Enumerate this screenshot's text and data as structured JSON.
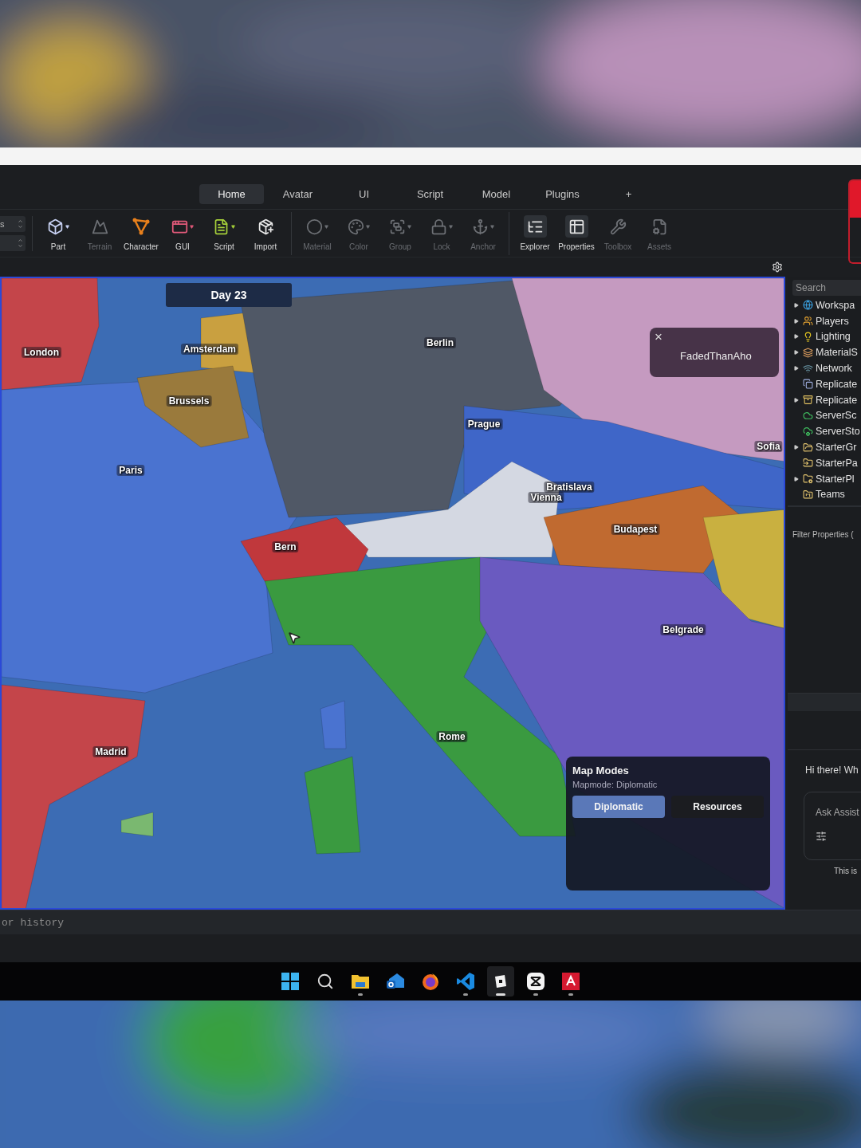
{
  "ribbon_tabs": [
    {
      "label": "Home",
      "selected": true
    },
    {
      "label": "Avatar",
      "selected": false
    },
    {
      "label": "UI",
      "selected": false
    },
    {
      "label": "Script",
      "selected": false
    },
    {
      "label": "Model",
      "selected": false
    },
    {
      "label": "Plugins",
      "selected": false
    },
    {
      "label": "+",
      "selected": false
    }
  ],
  "spinner_label": "s",
  "tool_groups": [
    [
      {
        "label": "Part",
        "disabled": false,
        "dropdown": true,
        "active": false
      },
      {
        "label": "Terrain",
        "disabled": true,
        "dropdown": false,
        "active": false
      },
      {
        "label": "Character",
        "disabled": false,
        "dropdown": false,
        "active": false
      },
      {
        "label": "GUI",
        "disabled": false,
        "dropdown": true,
        "active": false
      },
      {
        "label": "Script",
        "disabled": false,
        "dropdown": true,
        "active": false
      },
      {
        "label": "Import",
        "disabled": false,
        "dropdown": false,
        "active": false
      }
    ],
    [
      {
        "label": "Material",
        "disabled": true,
        "dropdown": true,
        "active": false
      },
      {
        "label": "Color",
        "disabled": true,
        "dropdown": true,
        "active": false
      },
      {
        "label": "Group",
        "disabled": true,
        "dropdown": true,
        "active": false
      },
      {
        "label": "Lock",
        "disabled": true,
        "dropdown": true,
        "active": false
      },
      {
        "label": "Anchor",
        "disabled": true,
        "dropdown": true,
        "active": false
      }
    ],
    [
      {
        "label": "Explorer",
        "disabled": false,
        "dropdown": false,
        "active": true
      },
      {
        "label": "Properties",
        "disabled": false,
        "dropdown": false,
        "active": true
      },
      {
        "label": "Toolbox",
        "disabled": true,
        "dropdown": false,
        "active": false
      },
      {
        "label": "Assets",
        "disabled": true,
        "dropdown": false,
        "active": false
      }
    ]
  ],
  "map": {
    "day": "Day 23",
    "cities": [
      "London",
      "Amsterdam",
      "Berlin",
      "Brussels",
      "Prague",
      "Paris",
      "Sofia",
      "Bratislava",
      "Vienna",
      "Budapest",
      "Bern",
      "Belgrade",
      "Rome",
      "Madrid"
    ],
    "player_popup": {
      "close": "×",
      "name": "FadedThanAho"
    },
    "map_modes": {
      "title": "Map Modes",
      "subtitle": "Mapmode: Diplomatic",
      "modes": [
        {
          "label": "Diplomatic",
          "selected": true
        },
        {
          "label": "Resources",
          "selected": false
        }
      ]
    }
  },
  "explorer": {
    "search_placeholder": "Search",
    "items": [
      {
        "label": "Workspa",
        "expandable": true
      },
      {
        "label": "Players",
        "expandable": true
      },
      {
        "label": "Lighting",
        "expandable": true
      },
      {
        "label": "MaterialS",
        "expandable": true
      },
      {
        "label": "Network",
        "expandable": true
      },
      {
        "label": "Replicate",
        "expandable": false
      },
      {
        "label": "Replicate",
        "expandable": true
      },
      {
        "label": "ServerSc",
        "expandable": false
      },
      {
        "label": "ServerSto",
        "expandable": false
      },
      {
        "label": "StarterGr",
        "expandable": true
      },
      {
        "label": "StarterPa",
        "expandable": false
      },
      {
        "label": "StarterPl",
        "expandable": true
      },
      {
        "label": "Teams",
        "expandable": false
      }
    ]
  },
  "properties": {
    "filter_placeholder": "Filter Properties ("
  },
  "assistant": {
    "greeting": "Hi there! Wh",
    "input_placeholder": "Ask Assist",
    "footer": "This is"
  },
  "command_bar": {
    "placeholder": "or history"
  },
  "taskbar": {
    "apps": [
      {
        "running": false,
        "active": false
      },
      {
        "running": false,
        "active": false
      },
      {
        "running": true,
        "active": false
      },
      {
        "running": false,
        "active": false
      },
      {
        "running": false,
        "active": false
      },
      {
        "running": true,
        "active": false
      },
      {
        "running": true,
        "active": true
      },
      {
        "running": true,
        "active": false
      },
      {
        "running": true,
        "active": false
      }
    ]
  }
}
